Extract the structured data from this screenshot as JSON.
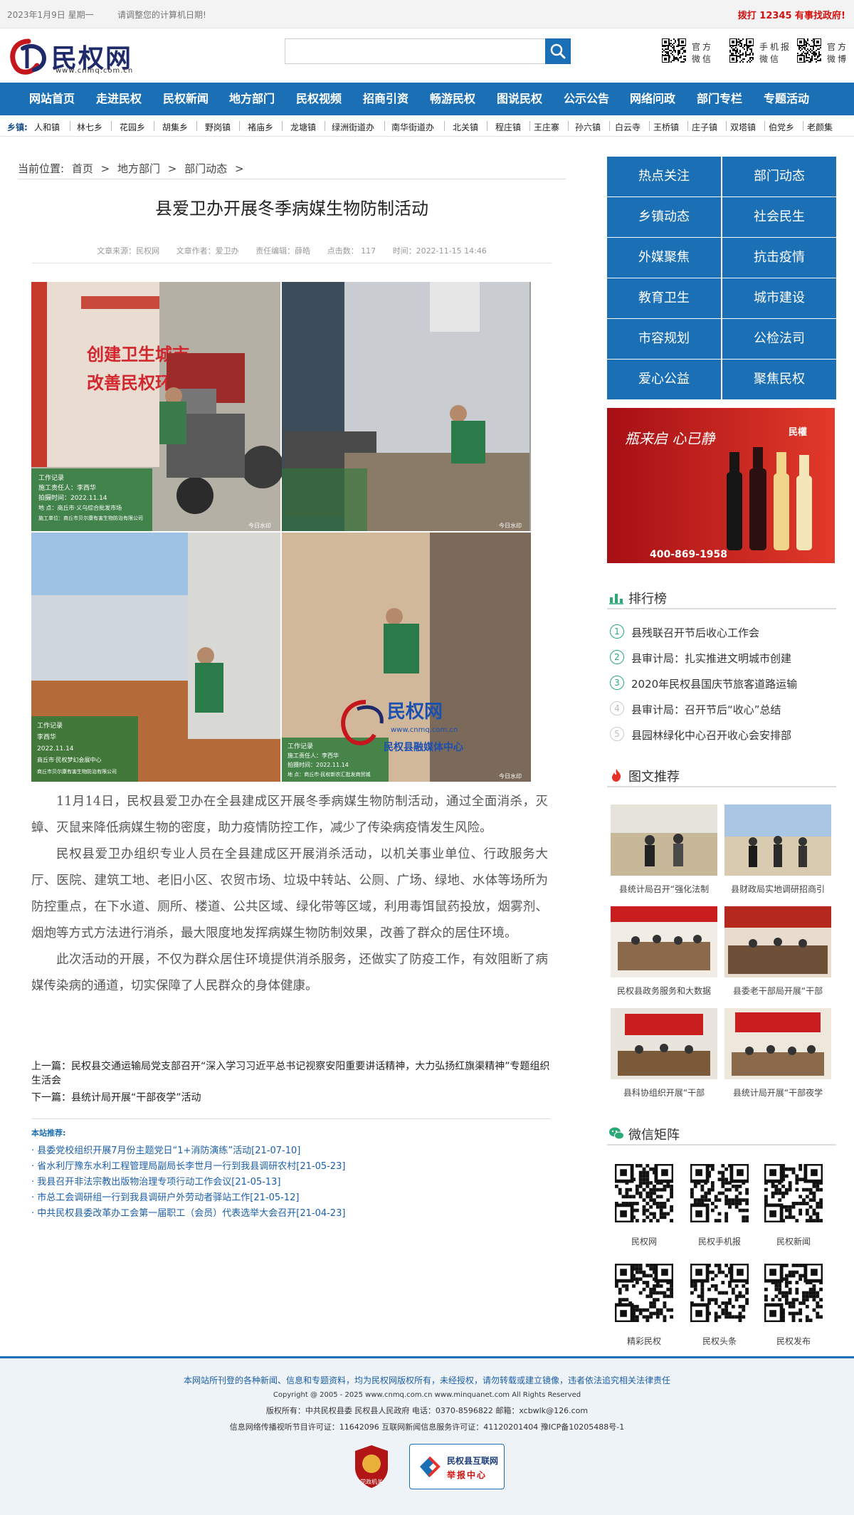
{
  "topbar": {
    "date": "2023年1月9日 星期一",
    "notice": "请调整您的计算机日期!",
    "hotline": "拨打 12345 有事找政府!"
  },
  "header": {
    "logo_text": "民权网",
    "logo_url": "www.cnmq.com.cn",
    "search_placeholder": "",
    "qr_items": [
      {
        "line1": "官方",
        "line2": "微信"
      },
      {
        "line1": "手机报",
        "line2": "微信"
      },
      {
        "line1": "官方",
        "line2": "微博"
      }
    ]
  },
  "nav": [
    "网站首页",
    "走进民权",
    "民权新闻",
    "地方部门",
    "民权视频",
    "招商引资",
    "畅游民权",
    "图说民权",
    "公示公告",
    "网络问政",
    "部门专栏",
    "专题活动"
  ],
  "towns": {
    "label": "乡镇:",
    "items": [
      "人和镇",
      "林七乡",
      "花园乡",
      "胡集乡",
      "野岗镇",
      "褚庙乡",
      "龙塘镇",
      "绿洲街道办",
      "南华街道办",
      "北关镇",
      "程庄镇",
      "王庄寨",
      "孙六镇",
      "白云寺",
      "王桥镇",
      "庄子镇",
      "双塔镇",
      "伯党乡",
      "老颜集"
    ]
  },
  "breadcrumb": [
    "当前位置:",
    "首页",
    ">",
    "地方部门",
    ">",
    "部门动态",
    ">"
  ],
  "article": {
    "title": "县爱卫办开展冬季病媒生物防制活动",
    "meta": {
      "source": "文章来源：民权网",
      "author": "文章作者：爱卫办",
      "editor": "责任编辑：薛皓",
      "clicks": "点击数： 117",
      "time": "时间：2022-11-15 14:46"
    },
    "photo_texts": {
      "banner1": "创建卫生城市",
      "banner2": "改善民权环境",
      "brand": "民权网",
      "brand_url": "www.cnmq.com.cn",
      "brand_sub": "民权县融媒体中心",
      "p1_lines": [
        "工作记录",
        "施工责任人：李西华",
        "拍摄时间：2022.11.14",
        "地 点：商丘市·义乌综合批发市场",
        "施工单位：商丘市贝尔康有害生物防治有限公司"
      ],
      "p3_lines": [
        "工作记录",
        "李西华",
        "2022.11.14",
        "商丘市·民权梦幻会展中心",
        "商丘市贝尔康有害生物防治有限公司"
      ],
      "p4_lines": [
        "工作记录",
        "施工责任人：李西华",
        "拍摄时间：2022.11.14",
        "地 点：商丘市·民权新农汇批发商贸城"
      ],
      "stamp": "今日水印"
    },
    "paragraphs": [
      "11月14日，民权县爱卫办在全县建成区开展冬季病媒生物防制活动，通过全面消杀，灭蟑、灭鼠来降低病媒生物的密度，助力疫情防控工作，减少了传染病疫情发生风险。",
      "民权县爱卫办组织专业人员在全县建成区开展消杀活动，以机关事业单位、行政服务大厅、医院、建筑工地、老旧小区、农贸市场、垃圾中转站、公厕、广场、绿地、水体等场所为防控重点，在下水道、厕所、楼道、公共区域、绿化带等区域，利用毒饵鼠药投放，烟雾剂、烟炮等方式方法进行消杀，最大限度地发挥病媒生物防制效果，改善了群众的居住环境。",
      "此次活动的开展，不仅为群众居住环境提供消杀服务，还做实了防疫工作，有效阻断了病媒传染病的通道，切实保障了人民群众的身体健康。"
    ],
    "prev": "上一篇：民权县交通运输局党支部召开“深入学习习近平总书记视察安阳重要讲话精神，大力弘扬红旗渠精神”专题组织生活会",
    "next": "下一篇：县统计局开展“干部夜学”活动"
  },
  "recommend": {
    "title": "本站推荐:",
    "items": [
      "· 县委党校组织开展7月份主题党日“1+消防演练”活动[21-07-10]",
      "· 省水利厅豫东水利工程管理局副局长李世月一行到我县调研农村[21-05-23]",
      "· 我县召开非法宗教出版物治理专项行动工作会议[21-05-13]",
      "· 市总工会调研组一行到我县调研户外劳动者驿站工作[21-05-12]",
      "· 中共民权县委改革办工会第一届职工（会员）代表选举大会召开[21-04-23]"
    ]
  },
  "sidebar": {
    "grid": [
      "热点关注",
      "部门动态",
      "乡镇动态",
      "社会民生",
      "外媒聚焦",
      "抗击疫情",
      "教育卫生",
      "城市建设",
      "市容规划",
      "公检法司",
      "爱心公益",
      "聚焦民权"
    ],
    "ad": {
      "slogan": "瓶来启 心已静",
      "brand": "民權",
      "phone": "400-869-1958"
    },
    "rank_title": "排行榜",
    "rank": [
      {
        "n": "1",
        "t": "县残联召开节后收心工作会"
      },
      {
        "n": "2",
        "t": "县审计局：扎实推进文明城市创建"
      },
      {
        "n": "3",
        "t": "2020年民权县国庆节旅客道路运输"
      },
      {
        "n": "4",
        "t": "县审计局：召开节后“收心”总结"
      },
      {
        "n": "5",
        "t": "县园林绿化中心召开收心会安排部"
      }
    ],
    "pics_title": "图文推荐",
    "pics": [
      "县统计局召开“强化法制",
      "县财政局实地调研招商引",
      "民权县政务服务和大数据",
      "县委老干部局开展“干部",
      "县科协组织开展“干部",
      "县统计局开展“干部夜学"
    ],
    "wx_title": "微信矩阵",
    "wx": [
      "民权网",
      "民权手机报",
      "民权新闻",
      "精彩民权",
      "民权头条",
      "民权发布"
    ]
  },
  "footer": {
    "l1": "本网站所刊登的各种新闻、信息和专题资料，均为民权网版权所有，未经授权，请勿转载或建立镜像，违者依法追究相关法律责任",
    "l2": "Copyright @ 2005 - 2025 www.cnmq.com.cn www.minquanet.com All Rights Reserved",
    "l3": "版权所有：中共民权县委 民权县人民政府 电话：0370-8596822 邮箱：xcbwlk@126.com",
    "l4": "信息网络传播视听节目许可证：11642096 互联网新闻信息服务许可证：41120201404 豫ICP备10205488号-1",
    "badge1": "党政机关",
    "badge2_line1": "民权县互联网",
    "badge2_line2": "举报中心"
  },
  "colors": {
    "primary": "#1b6fb5",
    "hotline": "#d2120f",
    "rank": "#2aa876"
  }
}
